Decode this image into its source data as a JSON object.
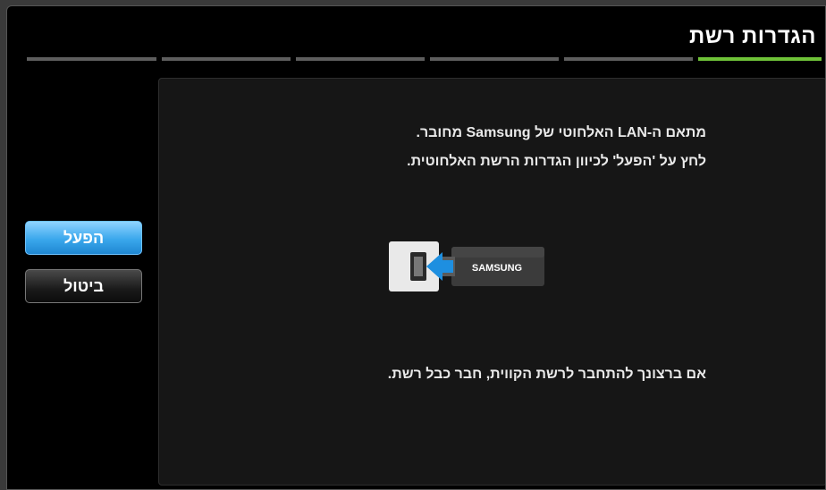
{
  "window": {
    "title": "הגדרות רשת"
  },
  "progress": {
    "total_steps": 6,
    "current_step": 1,
    "active_color": "#6fc238",
    "inactive_color": "#5e5e5e"
  },
  "content": {
    "line1": "מתאם ה-LAN האלחוטי של Samsung מחובר.",
    "line2": "לחץ על 'הפעל' לכיוון הגדרות הרשת האלחוטית.",
    "line3": "אם ברצונך להתחבר לרשת הקווית, חבר כבל רשת.",
    "device_brand": "SAMSUNG",
    "device_icon": "usb-wireless-adapter-icon"
  },
  "buttons": {
    "start_label": "הפעל",
    "cancel_label": "ביטול",
    "accent_color": "#3aa7ec"
  }
}
